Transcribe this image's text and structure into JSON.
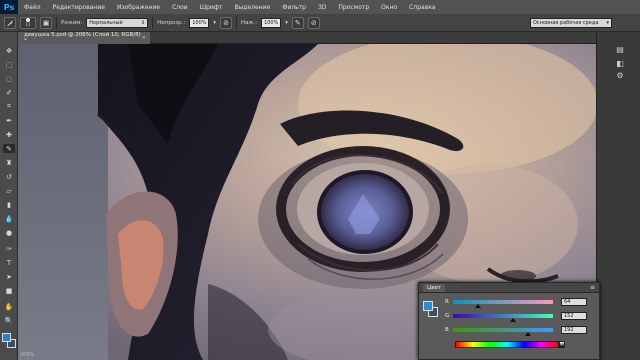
{
  "app": {
    "logo": "Ps",
    "menu": [
      "Файл",
      "Редактирование",
      "Изображение",
      "Слои",
      "Шрифт",
      "Выделение",
      "Фильтр",
      "3D",
      "Просмотр",
      "Окно",
      "Справка"
    ]
  },
  "options": {
    "brush_size": "11",
    "mode_label": "Режим:",
    "mode_value": "Нормальный",
    "opacity_label": "Непрозр.:",
    "opacity_value": "100%",
    "pressure_label": "Наж.:",
    "pressure_value": "100%",
    "workspace": "Основная рабочая среда"
  },
  "document": {
    "tab_title": "девушка 5.psd @ 206% (Слой 10, RGB/8) *",
    "close": "×",
    "zoom_status": "206%"
  },
  "color_panel": {
    "tab": "Цвет",
    "menu_icon": "≡",
    "rows": [
      {
        "letter": "R",
        "value": "64",
        "fraction": 0.25
      },
      {
        "letter": "G",
        "value": "152",
        "fraction": 0.6
      },
      {
        "letter": "B",
        "value": "192",
        "fraction": 0.75
      }
    ]
  },
  "colors": {
    "foreground": "#2f8ad0",
    "background": "#3e5164",
    "ps_blue": "#31a8ff"
  },
  "icons": {
    "tools": [
      "move-tool-icon",
      "marquee-tool-icon",
      "lasso-tool-icon",
      "quick-select-icon",
      "crop-tool-icon",
      "eyedropper-icon",
      "healing-brush-icon",
      "brush-tool-icon",
      "clone-stamp-icon",
      "history-brush-icon",
      "eraser-icon",
      "gradient-icon",
      "blur-icon",
      "dodge-icon",
      "pen-tool-icon",
      "type-tool-icon",
      "path-select-icon",
      "shape-tool-icon",
      "hand-tool-icon",
      "zoom-tool-icon"
    ]
  }
}
